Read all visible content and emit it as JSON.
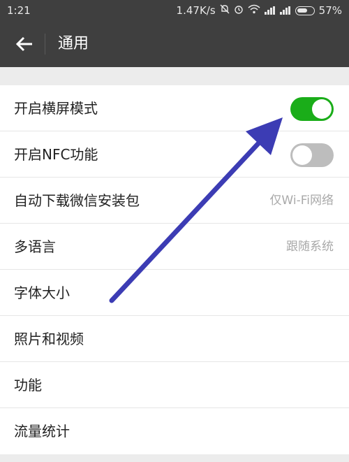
{
  "status_bar": {
    "time": "1:21",
    "network_speed": "1.47K/s",
    "battery_percent": "57%",
    "icons": [
      "mute-icon",
      "alarm-icon",
      "wifi-icon",
      "signal-icon",
      "signal-icon",
      "battery-icon"
    ]
  },
  "header": {
    "title": "通用",
    "back_icon": "back-arrow-icon"
  },
  "settings": {
    "items": [
      {
        "label": "开启横屏模式",
        "type": "toggle",
        "state": "on"
      },
      {
        "label": "开启NFC功能",
        "type": "toggle",
        "state": "off"
      },
      {
        "label": "自动下载微信安装包",
        "value": "仅Wi-Fi网络"
      },
      {
        "label": "多语言",
        "value": "跟随系统"
      },
      {
        "label": "字体大小"
      },
      {
        "label": "照片和视频"
      },
      {
        "label": "功能"
      },
      {
        "label": "流量统计"
      }
    ]
  },
  "colors": {
    "toolbar": "#3f3f3f",
    "toggle_on": "#1aad19",
    "toggle_off": "#bdbdbd",
    "annotation_arrow": "#3c3cb4"
  }
}
